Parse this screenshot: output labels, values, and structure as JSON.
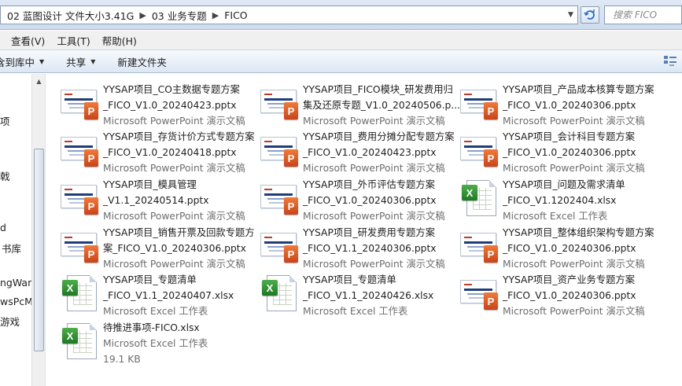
{
  "address": {
    "segments": [
      "02 蓝图设计 文件大小3.41G",
      "03 业务专题",
      "FICO"
    ],
    "separator": "▶"
  },
  "search": {
    "placeholder": "搜索 FICO"
  },
  "menu": [
    "查看(V)",
    "工具(T)",
    "帮助(H)"
  ],
  "toolbar": {
    "include_label": "含到库中",
    "share_label": "共享",
    "new_folder_label": "新建文件夹"
  },
  "nav": {
    "items": [
      "项",
      "戟",
      "d",
      "书库",
      "ngWan",
      "wsPcMa",
      "游戏"
    ]
  },
  "files": [
    {
      "name1": "YYSAP项目_CO主数据专题方案",
      "name2": "_FICO_V1.0_20240423.pptx",
      "type": "Microsoft PowerPoint 演示文稿",
      "icon": "ppt"
    },
    {
      "name1": "YYSAP项目_FICO模块_研发费用归",
      "name2": "集及还原专题_V1.0_20240506.p...",
      "type": "Microsoft PowerPoint 演示文稿",
      "icon": "ppt"
    },
    {
      "name1": "YYSAP项目_产品成本核算专题方案",
      "name2": "_FICO_V1.0_20240306.pptx",
      "type": "Microsoft PowerPoint 演示文稿",
      "icon": "ppt"
    },
    {
      "name1": "YYSAP项目_存货计价方式专题方案",
      "name2": "_FICO_V1.0_20240418.pptx",
      "type": "Microsoft PowerPoint 演示文稿",
      "icon": "ppt"
    },
    {
      "name1": "YYSAP项目_费用分摊分配专题方案",
      "name2": "_FICO_V1.0_20240423.pptx",
      "type": "Microsoft PowerPoint 演示文稿",
      "icon": "ppt"
    },
    {
      "name1": "YYSAP项目_会计科目专题方案",
      "name2": "_FICO_V1.0_20240306.pptx",
      "type": "Microsoft PowerPoint 演示文稿",
      "icon": "ppt"
    },
    {
      "name1": "YYSAP项目_模具管理",
      "name2": "_V1.1_20240514.pptx",
      "type": "Microsoft PowerPoint 演示文稿",
      "icon": "ppt"
    },
    {
      "name1": "YYSAP项目_外币评估专题方案",
      "name2": "_FICO_V1.0_20240306.pptx",
      "type": "Microsoft PowerPoint 演示文稿",
      "icon": "ppt"
    },
    {
      "name1": "YYSAP项目_问题及需求清单",
      "name2": "_FICO_V1.1202404.xlsx",
      "type": "Microsoft Excel 工作表",
      "icon": "xls"
    },
    {
      "name1": "YYSAP项目_销售开票及回款专题方",
      "name2": "案_FICO_V1.0_20240306.pptx",
      "type": "Microsoft PowerPoint 演示文稿",
      "icon": "ppt"
    },
    {
      "name1": "YYSAP项目_研发费用专题方案",
      "name2": "_FICO_V1.1_20240306.pptx",
      "type": "Microsoft PowerPoint 演示文稿",
      "icon": "ppt"
    },
    {
      "name1": "YYSAP项目_整体组织架构专题方案",
      "name2": "_FICO_V1.0_20240306.pptx",
      "type": "Microsoft PowerPoint 演示文稿",
      "icon": "ppt"
    },
    {
      "name1": "YYSAP项目_专题清单",
      "name2": "_FICO_V1.1_20240407.xlsx",
      "type": "Microsoft Excel 工作表",
      "icon": "xls"
    },
    {
      "name1": "YYSAP项目_专题清单",
      "name2": "_FICO_V1.1_20240426.xlsx",
      "type": "Microsoft Excel 工作表",
      "icon": "xls"
    },
    {
      "name1": "YYSAP项目_资产业务专题方案",
      "name2": "_FICO_V1.0_20240306.pptx",
      "type": "Microsoft PowerPoint 演示文稿",
      "icon": "ppt"
    },
    {
      "name1": "待推进事项-FICO.xlsx",
      "name2": "Microsoft Excel 工作表",
      "type": "19.1 KB",
      "icon": "xls",
      "alt": true
    }
  ]
}
